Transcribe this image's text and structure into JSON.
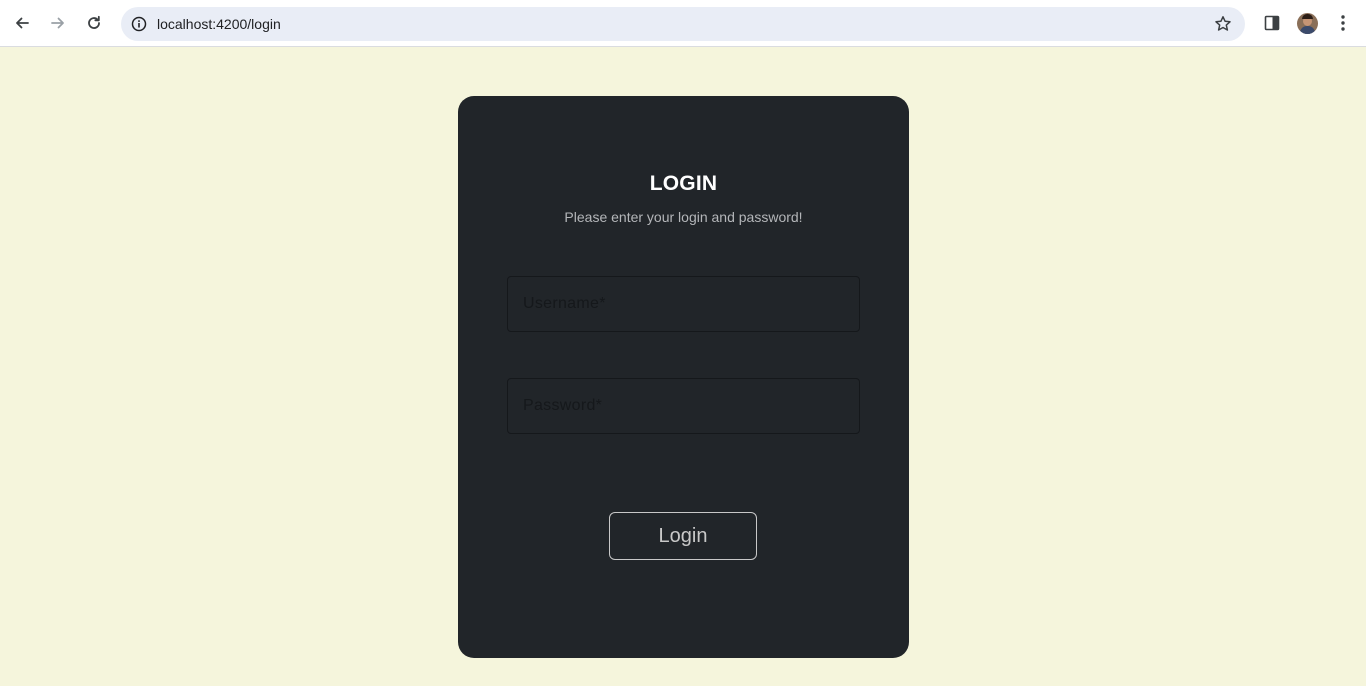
{
  "browser": {
    "url": "localhost:4200/login",
    "icons": [
      "back-icon",
      "forward-icon",
      "reload-icon",
      "site-info-icon",
      "bookmark-star-icon",
      "side-panel-icon",
      "profile-avatar",
      "menu-kebab-icon"
    ]
  },
  "login_card": {
    "title": "LOGIN",
    "subtitle": "Please enter your login and password!",
    "username_placeholder": "Username*",
    "password_placeholder": "Password*",
    "login_button": "Login"
  },
  "colors": {
    "page_background": "#f5f5dc",
    "card_background": "#212529",
    "title_text": "#ffffff",
    "subtitle_text": "#b4b6b9",
    "button_border": "#c8c8c8"
  }
}
